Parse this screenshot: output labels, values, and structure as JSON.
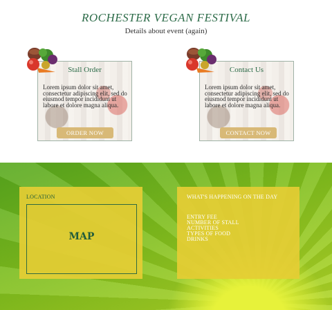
{
  "header": {
    "title": "ROCHESTER VEGAN FESTIVAL",
    "subtitle": "Details about event (again)"
  },
  "cards": [
    {
      "title": "Stall Order",
      "text": "Lorem ipsum dolor sit amet, consectetur adipiscing elit, sed do eiusmod tempor incididunt ut labore et dolore magna aliqua.",
      "button": "ORDER NOW"
    },
    {
      "title": "Contact Us",
      "text": "Lorem ipsum dolor sit amet, consectetur adipiscing elit, sed do eiusmod tempor incididunt ut labore et dolore magna aliqua.",
      "button": "CONTACT NOW"
    }
  ],
  "location": {
    "heading": "LOCATION",
    "map_label": "MAP"
  },
  "happening": {
    "heading": "WHAT'S HAPPENING ON THE DAY",
    "items": [
      "ENTRY FEE",
      "NUMBER OF STALL",
      "ACTIVITIES",
      "TYPES OF FOOD",
      "DRINKS"
    ]
  },
  "icons": [
    "vegetables-icon"
  ],
  "colors": {
    "title_green": "#2c6b48",
    "button_gold": "#d8b977",
    "panel_yellow": "#e5cd34",
    "background_green": "#7fbe1d"
  }
}
